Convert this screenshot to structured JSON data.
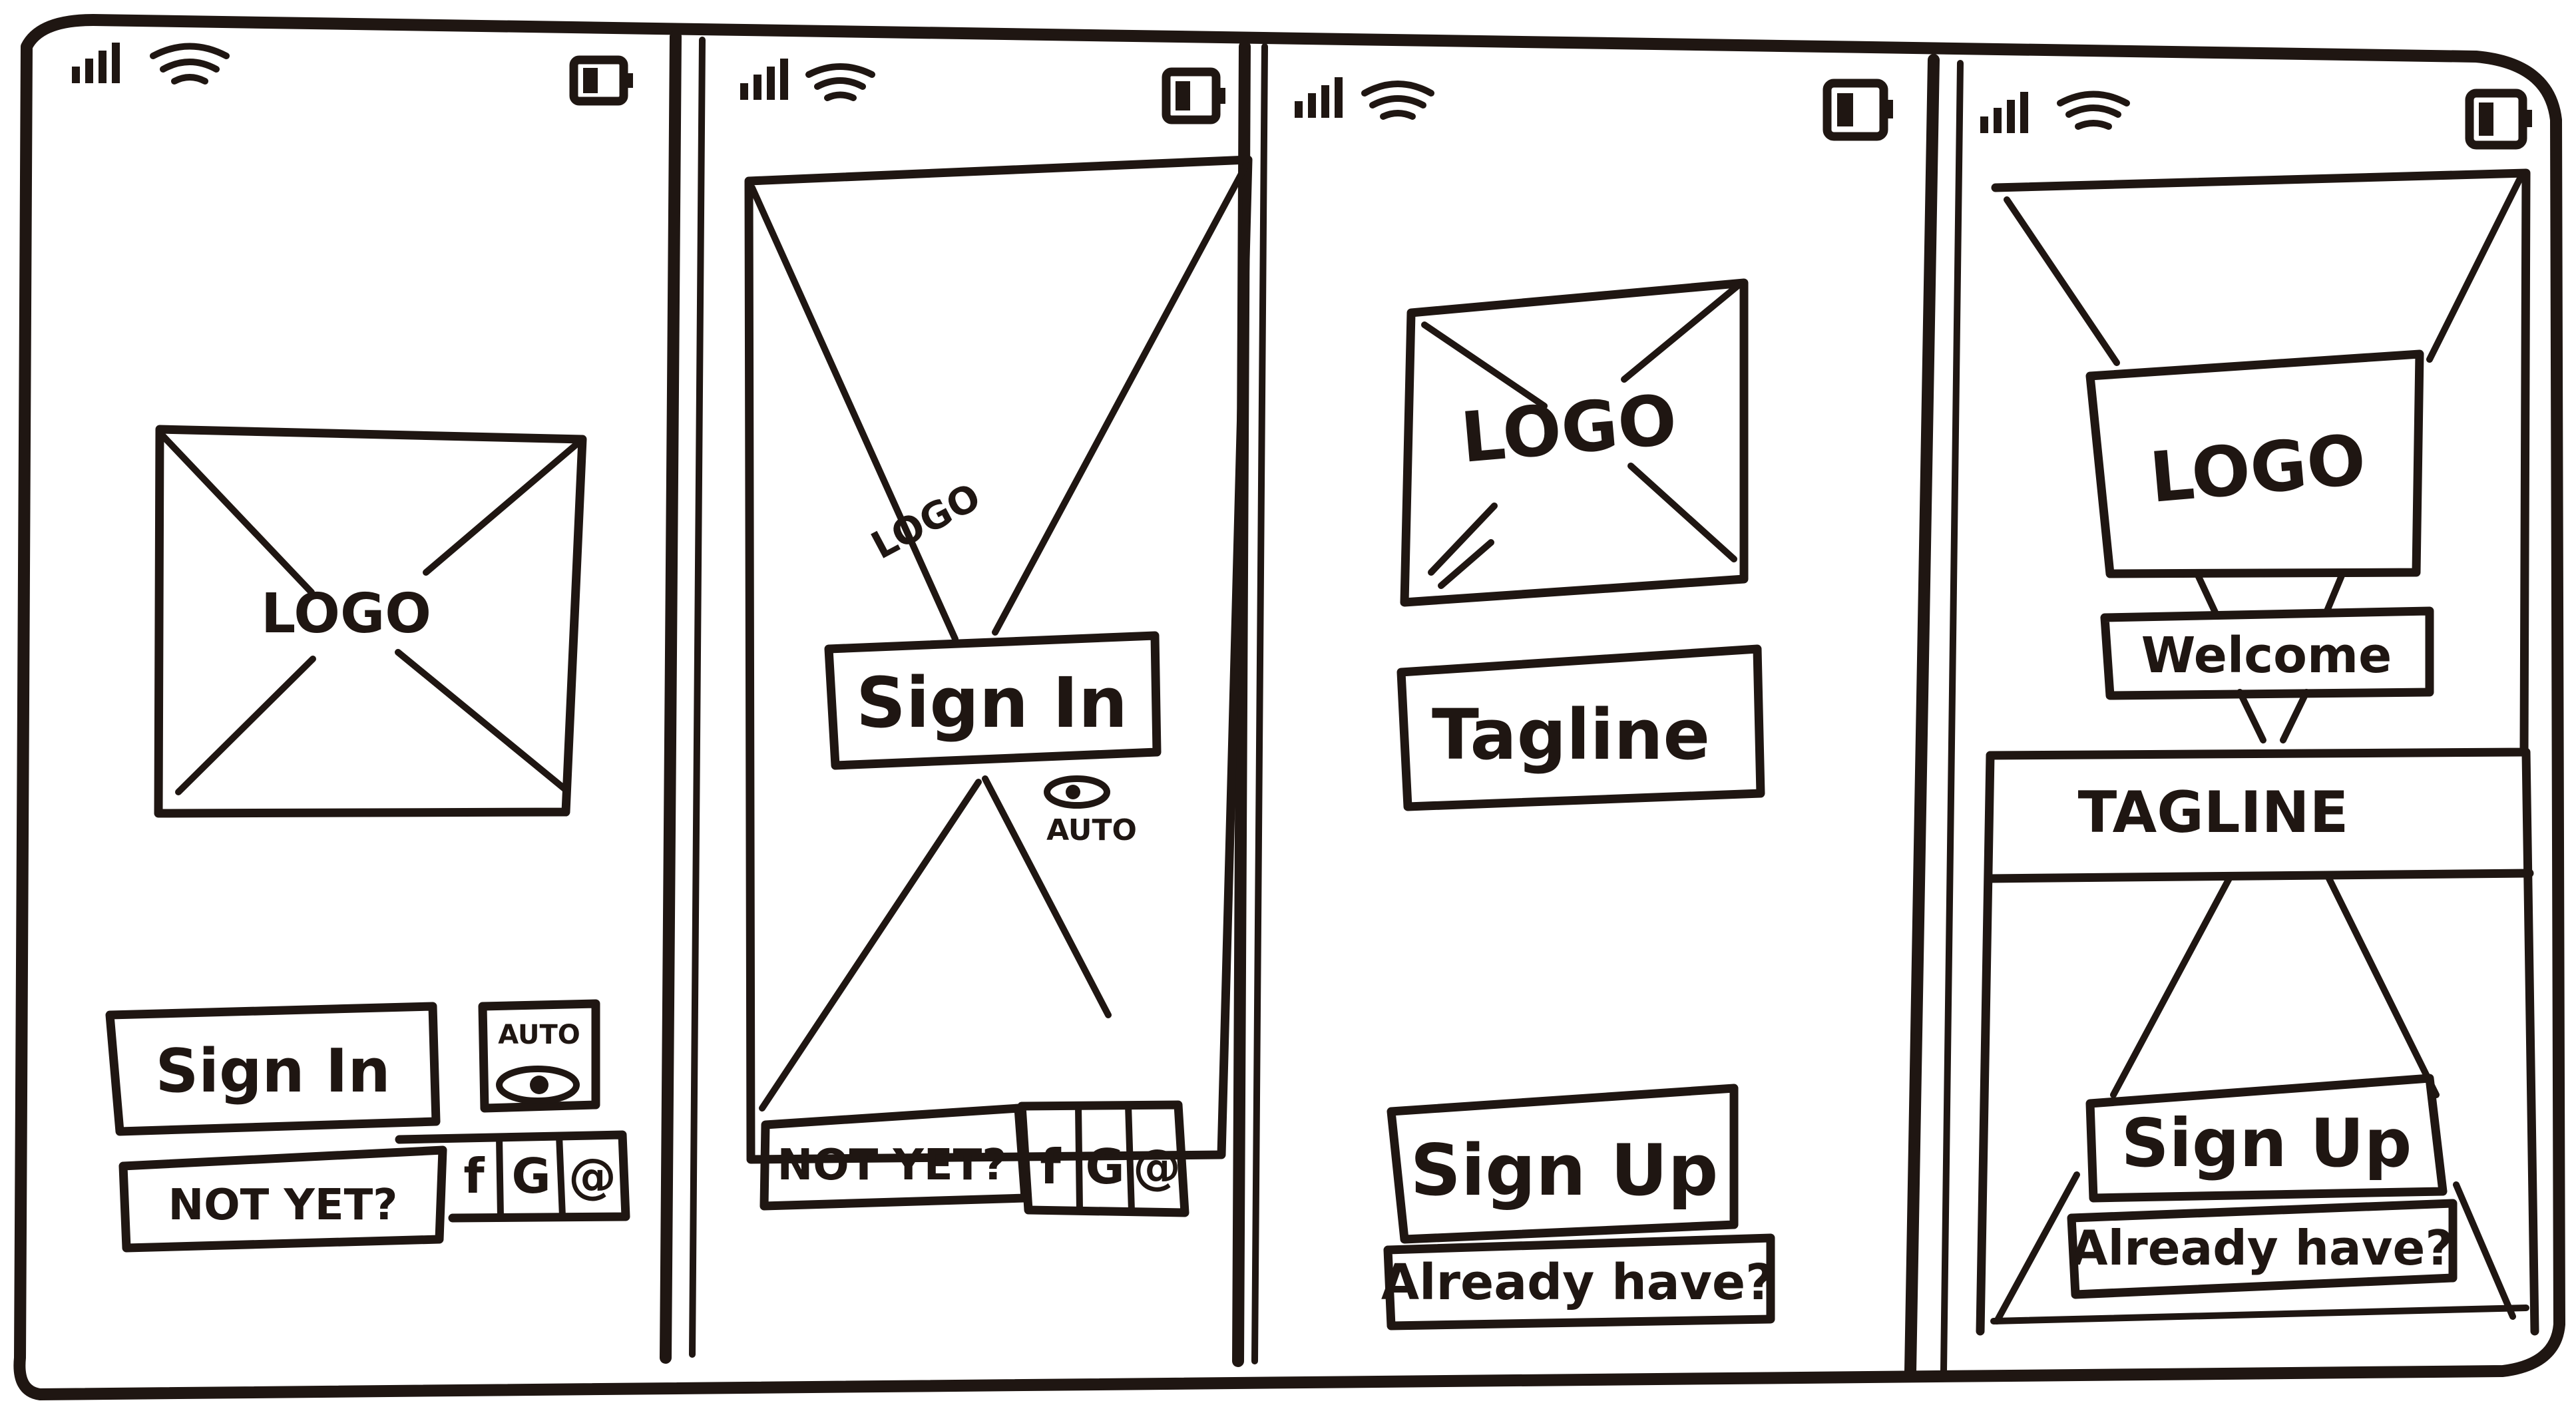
{
  "screens": [
    {
      "logo": "LOGO",
      "sign_in": "Sign In",
      "auto": "AUTO",
      "not_yet": "NOT YET?",
      "social": [
        "f",
        "G",
        "@"
      ]
    },
    {
      "logo": "LOGO",
      "sign_in": "Sign In",
      "auto": "AUTO",
      "not_yet": "NOT YET?",
      "social": [
        "f",
        "G",
        "@"
      ]
    },
    {
      "logo": "LOGO",
      "tagline": "Tagline",
      "sign_up": "Sign Up",
      "already": "Already have?"
    },
    {
      "logo": "LOGO",
      "welcome": "Welcome",
      "tagline": "TAGLINE",
      "sign_up": "Sign Up",
      "already": "Already have?"
    }
  ]
}
